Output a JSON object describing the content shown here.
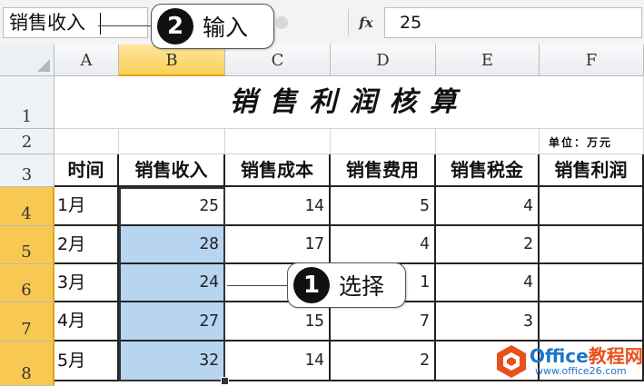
{
  "formula_bar": {
    "name_box_text": "销售收入",
    "fx_label": "fx",
    "formula_value": "25"
  },
  "columns": [
    "A",
    "B",
    "C",
    "D",
    "E",
    "F"
  ],
  "rows": [
    "1",
    "2",
    "3",
    "4",
    "5",
    "6",
    "7",
    "8"
  ],
  "sheet": {
    "title": "销售利润核算",
    "unit_label": "单位：万元",
    "headers": [
      "时间",
      "销售收入",
      "销售成本",
      "销售费用",
      "销售税金",
      "销售利润"
    ],
    "data": [
      {
        "month": "1月",
        "revenue": "25",
        "cost": "14",
        "expense": "5",
        "tax": "4",
        "profit": ""
      },
      {
        "month": "2月",
        "revenue": "28",
        "cost": "17",
        "expense": "4",
        "tax": "2",
        "profit": ""
      },
      {
        "month": "3月",
        "revenue": "24",
        "cost": "",
        "expense": "1",
        "tax": "4",
        "profit": ""
      },
      {
        "month": "4月",
        "revenue": "27",
        "cost": "15",
        "expense": "7",
        "tax": "3",
        "profit": ""
      },
      {
        "month": "5月",
        "revenue": "32",
        "cost": "14",
        "expense": "2",
        "tax": "",
        "profit": ""
      }
    ]
  },
  "callouts": {
    "step1": {
      "number": "1",
      "text": "选择"
    },
    "step2": {
      "number": "2",
      "text": "输入"
    }
  },
  "watermark": {
    "brand_en": "Office",
    "brand_cn": "教程网",
    "url": "www.office26.com"
  }
}
